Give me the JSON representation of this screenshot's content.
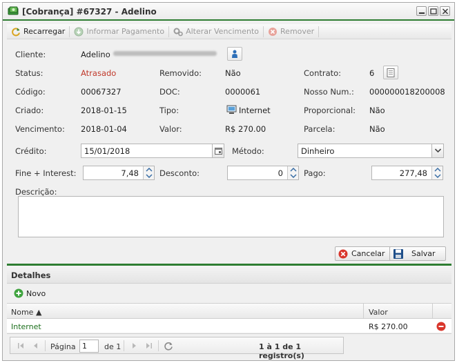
{
  "window": {
    "title": "[Cobrança] #67327 - Adelino"
  },
  "toolbar": {
    "reload": "Recarregar",
    "inform_payment": "Informar Pagamento",
    "change_due": "Alterar Vencimento",
    "remove": "Remover"
  },
  "details": {
    "cliente_label": "Cliente:",
    "cliente_value": "Adelino",
    "status_label": "Status:",
    "status_value": "Atrasado",
    "removido_label": "Removido:",
    "removido_value": "Não",
    "contrato_label": "Contrato:",
    "contrato_value": "6",
    "codigo_label": "Código:",
    "codigo_value": "00067327",
    "doc_label": "DOC:",
    "doc_value": "0000061",
    "nosso_label": "Nosso Num.:",
    "nosso_value": "000000018200008",
    "criado_label": "Criado:",
    "criado_value": "2018-01-15",
    "tipo_label": "Tipo:",
    "tipo_value": "Internet",
    "proporcional_label": "Proporcional:",
    "proporcional_value": "Não",
    "vencimento_label": "Vencimento:",
    "vencimento_value": "2018-01-04",
    "valor_label": "Valor:",
    "valor_value": "R$ 270.00",
    "parcela_label": "Parcela:",
    "parcela_value": "Não"
  },
  "form": {
    "credito_label": "Crédito:",
    "credito_value": "15/01/2018",
    "metodo_label": "Método:",
    "metodo_value": "Dinheiro",
    "fine_label": "Fine + Interest:",
    "fine_value": "7,48",
    "desconto_label": "Desconto:",
    "desconto_value": "0",
    "pago_label": "Pago:",
    "pago_value": "277,48",
    "descricao_label": "Descrição:",
    "descricao_value": "",
    "cancel": "Cancelar",
    "save": "Salvar"
  },
  "detalhes": {
    "title": "Detalhes",
    "new": "Novo",
    "columns": {
      "nome": "Nome ▲",
      "valor": "Valor"
    },
    "rows": [
      {
        "nome": "Internet",
        "valor": "R$ 270.00"
      }
    ]
  },
  "pager": {
    "page_label": "Página",
    "page_value": "1",
    "of_label": "de 1",
    "summary": "1 à 1 de 1 registro(s)"
  },
  "colors": {
    "accent": "#2e7d32",
    "status_red": "#c0392b",
    "link_green": "#1b6e1b"
  }
}
